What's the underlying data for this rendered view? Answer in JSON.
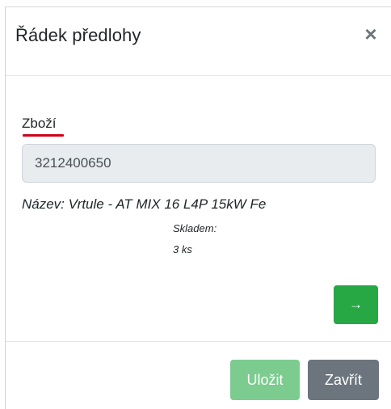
{
  "modal": {
    "title": "Řádek předlohy",
    "close_glyph": "×",
    "close_icon": "close-icon"
  },
  "form": {
    "product_label": "Zboží",
    "product_value": "3212400650",
    "product_name": "Název: Vrtule - AT MIX 16 L4P 15kW Fe",
    "stock_label": "Skladem:",
    "stock_value": "3 ks",
    "confirm_glyph": "→",
    "confirm_icon": "arrow-right-icon"
  },
  "footer": {
    "save_label": "Uložit",
    "close_label": "Zavřít"
  },
  "colors": {
    "success": "#28a745",
    "success_disabled": "#7ccb8f",
    "secondary": "#6c757d",
    "label_underline": "#d0021b",
    "input_background": "#e9ecef"
  }
}
